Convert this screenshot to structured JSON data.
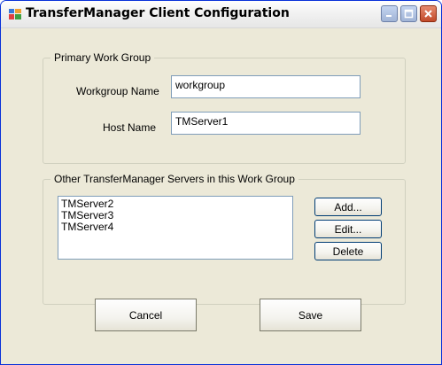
{
  "window": {
    "title": "TransferManager Client Configuration",
    "minimize_icon": "minimize-icon",
    "maximize_icon": "maximize-icon",
    "close_icon": "close-icon"
  },
  "primary_group": {
    "legend": "Primary Work Group",
    "workgroup_name_label": "Workgroup Name",
    "workgroup_name_value": "workgroup",
    "host_name_label": "Host Name",
    "host_name_value": "TMServer1"
  },
  "other_servers": {
    "legend": "Other TransferManager Servers in this Work Group",
    "items": [
      "TMServer2",
      "TMServer3",
      "TMServer4"
    ],
    "add_label": "Add...",
    "edit_label": "Edit...",
    "delete_label": "Delete"
  },
  "footer": {
    "cancel_label": "Cancel",
    "save_label": "Save"
  },
  "colors": {
    "face": "#ece9d8",
    "field_border": "#7f9db9",
    "close_button": "#c24a2a"
  }
}
